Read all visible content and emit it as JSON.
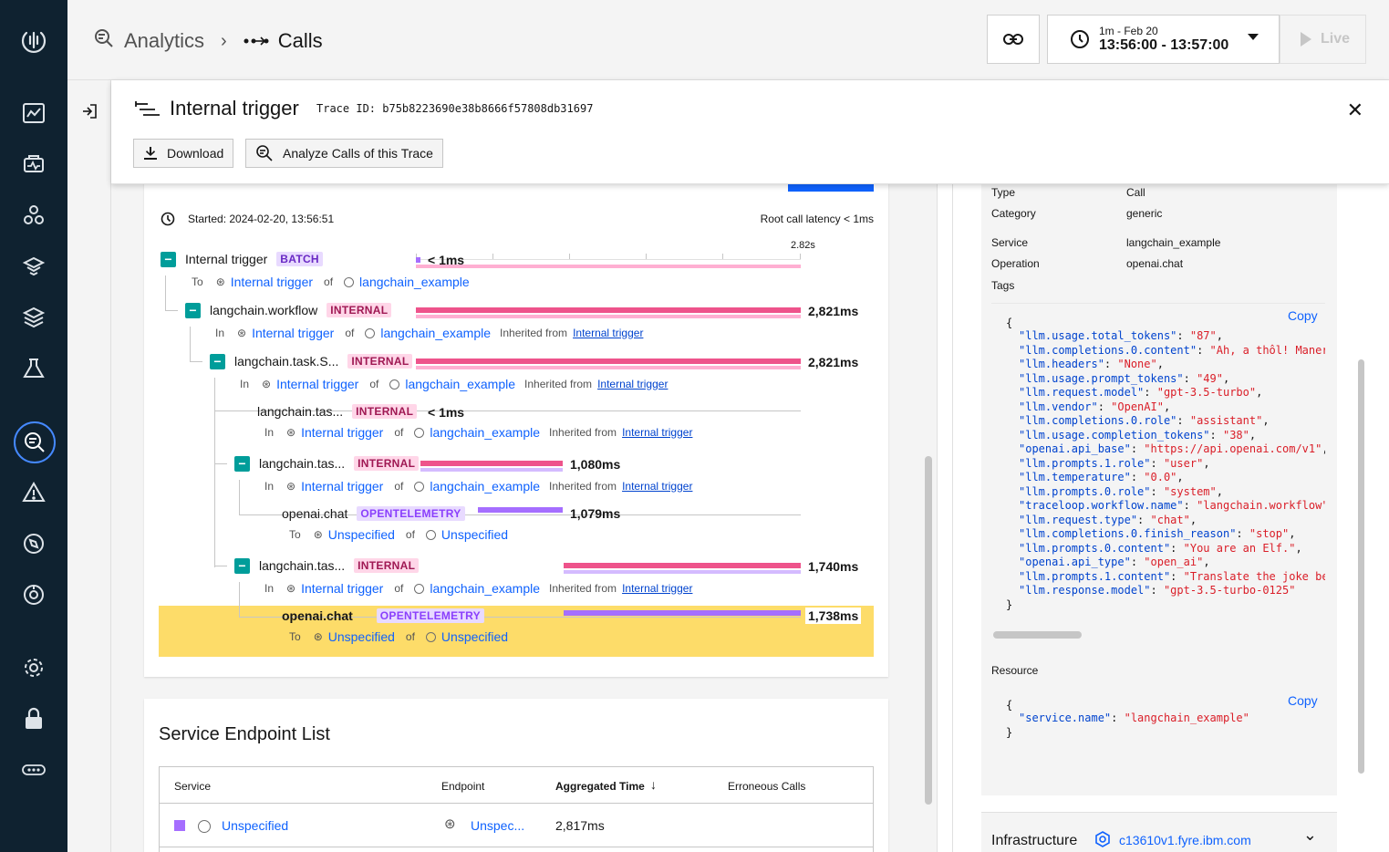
{
  "breadcrumb": {
    "root": "Analytics",
    "current": "Calls"
  },
  "time": {
    "range": "1m - Feb 20",
    "window": "13:56:00 - 13:57:00",
    "live": "Live"
  },
  "drawer": {
    "title": "Internal trigger",
    "trace_label": "Trace ID: b75b8223690e38b8666f57808db31697",
    "download": "Download",
    "analyze": "Analyze Calls of this Trace"
  },
  "trace": {
    "started": "Started: 2024-02-20, 13:56:51",
    "root_latency": "Root call latency < 1ms",
    "scale_label": "2.82s",
    "rows": [
      {
        "name": "Internal trigger",
        "tag": "BATCH",
        "duration": "< 1ms",
        "sub_prefix": "To",
        "sub_a": "Internal trigger",
        "of": "of",
        "sub_b": "langchain_example",
        "inherit": "",
        "inherit_link": ""
      },
      {
        "name": "langchain.workflow",
        "tag": "INTERNAL",
        "duration": "2,821ms",
        "sub_prefix": "In",
        "sub_a": "Internal trigger",
        "of": "of",
        "sub_b": "langchain_example",
        "inherit": "Inherited from",
        "inherit_link": "Internal trigger"
      },
      {
        "name": "langchain.task.S...",
        "tag": "INTERNAL",
        "duration": "2,821ms",
        "sub_prefix": "In",
        "sub_a": "Internal trigger",
        "of": "of",
        "sub_b": "langchain_example",
        "inherit": "Inherited from",
        "inherit_link": "Internal trigger"
      },
      {
        "name": "langchain.tas...",
        "tag": "INTERNAL",
        "duration": "< 1ms",
        "sub_prefix": "In",
        "sub_a": "Internal trigger",
        "of": "of",
        "sub_b": "langchain_example",
        "inherit": "Inherited from",
        "inherit_link": "Internal trigger"
      },
      {
        "name": "langchain.tas...",
        "tag": "INTERNAL",
        "duration": "1,080ms",
        "sub_prefix": "In",
        "sub_a": "Internal trigger",
        "of": "of",
        "sub_b": "langchain_example",
        "inherit": "Inherited from",
        "inherit_link": "Internal trigger"
      },
      {
        "name": "openai.chat",
        "tag": "OPENTELEMETRY",
        "duration": "1,079ms",
        "sub_prefix": "To",
        "sub_a": "Unspecified",
        "of": "of",
        "sub_b": "Unspecified",
        "inherit": "",
        "inherit_link": ""
      },
      {
        "name": "langchain.tas...",
        "tag": "INTERNAL",
        "duration": "1,740ms",
        "sub_prefix": "In",
        "sub_a": "Internal trigger",
        "of": "of",
        "sub_b": "langchain_example",
        "inherit": "Inherited from",
        "inherit_link": "Internal trigger"
      },
      {
        "name": "openai.chat",
        "tag": "OPENTELEMETRY",
        "duration": "1,738ms",
        "sub_prefix": "To",
        "sub_a": "Unspecified",
        "of": "of",
        "sub_b": "Unspecified",
        "inherit": "",
        "inherit_link": ""
      }
    ]
  },
  "endpoints": {
    "title": "Service Endpoint List",
    "col_service": "Service",
    "col_endpoint": "Endpoint",
    "col_time": "Aggregated Time",
    "col_errors": "Erroneous Calls",
    "row_service": "Unspecified",
    "row_endpoint": "Unspec...",
    "row_time": "2,817ms"
  },
  "details": {
    "type_k": "Type",
    "type_v": "Call",
    "cat_k": "Category",
    "cat_v": "generic",
    "svc_k": "Service",
    "svc_v": "langchain_example",
    "op_k": "Operation",
    "op_v": "openai.chat",
    "tags_k": "Tags",
    "copy": "Copy",
    "resource_k": "Resource",
    "infra_k": "Infrastructure",
    "infra_v": "c13610v1.fyre.ibm.com"
  },
  "tags_json": [
    [
      "\"llm.usage.total_tokens\"",
      "\"87\""
    ],
    [
      "\"llm.completions.0.content\"",
      "\"Ah, a thôl! Maner"
    ],
    [
      "\"llm.headers\"",
      "\"None\""
    ],
    [
      "\"llm.usage.prompt_tokens\"",
      "\"49\""
    ],
    [
      "\"llm.request.model\"",
      "\"gpt-3.5-turbo\""
    ],
    [
      "\"llm.vendor\"",
      "\"OpenAI\""
    ],
    [
      "\"llm.completions.0.role\"",
      "\"assistant\""
    ],
    [
      "\"llm.usage.completion_tokens\"",
      "\"38\""
    ],
    [
      "\"openai.api_base\"",
      "\"https://api.openai.com/v1\""
    ],
    [
      "\"llm.prompts.1.role\"",
      "\"user\""
    ],
    [
      "\"llm.temperature\"",
      "\"0.0\""
    ],
    [
      "\"llm.prompts.0.role\"",
      "\"system\""
    ],
    [
      "\"traceloop.workflow.name\"",
      "\"langchain.workflow\""
    ],
    [
      "\"llm.request.type\"",
      "\"chat\""
    ],
    [
      "\"llm.completions.0.finish_reason\"",
      "\"stop\""
    ],
    [
      "\"llm.prompts.0.content\"",
      "\"You are an Elf.\""
    ],
    [
      "\"openai.api_type\"",
      "\"open_ai\""
    ],
    [
      "\"llm.prompts.1.content\"",
      "\"Translate the joke be"
    ],
    [
      "\"llm.response.model\"",
      "\"gpt-3.5-turbo-0125\""
    ]
  ],
  "resource_json": [
    [
      "\"service.name\"",
      "\"langchain_example\""
    ]
  ],
  "colors": {
    "accent": "#0f62fe",
    "internal": "#ee538b",
    "otel": "#a56eff",
    "highlight": "#fddc69",
    "nav": "#0f2230"
  }
}
